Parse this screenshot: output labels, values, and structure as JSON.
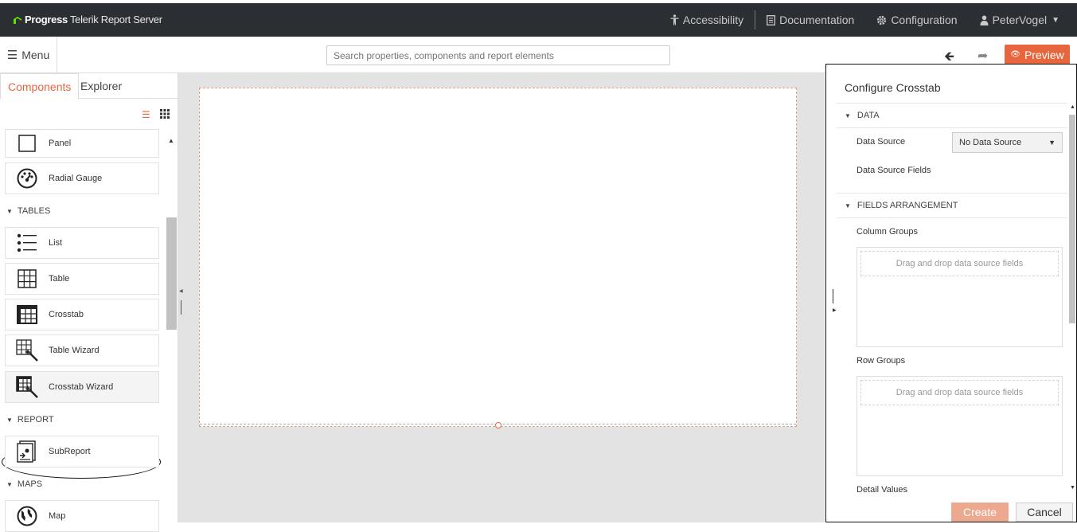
{
  "header": {
    "brand_bold": "Progress",
    "brand_rest": "Telerik Report Server",
    "nav": {
      "accessibility": "Accessibility",
      "documentation": "Documentation",
      "configuration": "Configuration",
      "user": "PeterVogel"
    }
  },
  "toolbar": {
    "menu_label": "Menu",
    "search_placeholder": "Search properties, components and report elements",
    "preview_label": "Preview"
  },
  "left_panel": {
    "tabs": [
      "Components",
      "Explorer"
    ],
    "items_top": [
      {
        "label": "Panel",
        "icon": "panel-icon"
      },
      {
        "label": "Radial Gauge",
        "icon": "radial-gauge-icon"
      }
    ],
    "categories": {
      "tables": "TABLES",
      "report": "REPORT",
      "maps": "MAPS"
    },
    "tables_items": [
      {
        "label": "List",
        "icon": "list-icon"
      },
      {
        "label": "Table",
        "icon": "table-icon"
      },
      {
        "label": "Crosstab",
        "icon": "crosstab-icon"
      },
      {
        "label": "Table Wizard",
        "icon": "table-wizard-icon"
      },
      {
        "label": "Crosstab Wizard",
        "icon": "crosstab-wizard-icon"
      }
    ],
    "report_items": [
      {
        "label": "SubReport",
        "icon": "subreport-icon"
      }
    ],
    "maps_items": [
      {
        "label": "Map",
        "icon": "map-icon"
      }
    ]
  },
  "right_panel": {
    "title": "Configure Crosstab",
    "sections": {
      "data": "DATA",
      "fields_arrangement": "FIELDS ARRANGEMENT"
    },
    "data_source_label": "Data Source",
    "data_source_value": "No Data Source",
    "data_source_fields_label": "Data Source Fields",
    "column_groups_label": "Column Groups",
    "row_groups_label": "Row Groups",
    "detail_values_label": "Detail Values",
    "dropzone_text": "Drag and drop data source fields",
    "create_label": "Create",
    "cancel_label": "Cancel"
  },
  "colors": {
    "accent": "#e8663d",
    "header_bg": "#2b2e33",
    "canvas_bg": "#e3e3e3"
  }
}
